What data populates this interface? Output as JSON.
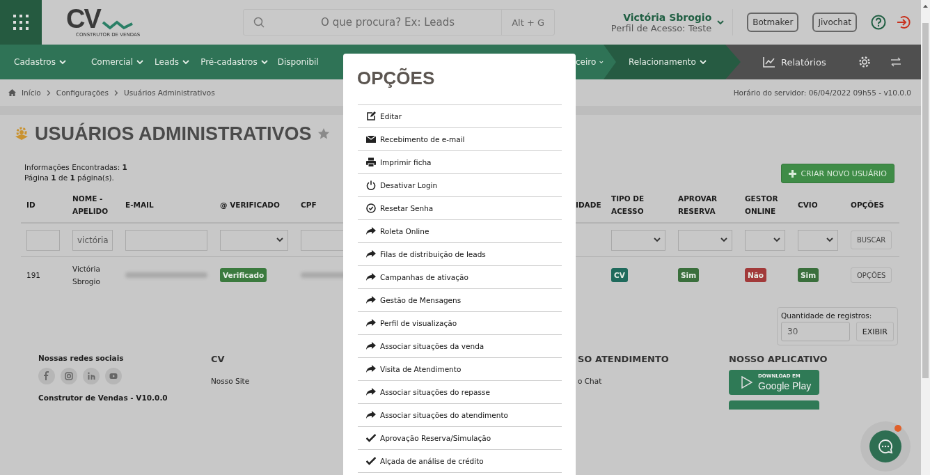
{
  "header": {
    "logo": {
      "mark": "CV",
      "tagline": "CONSTRUTOR DE VENDAS"
    },
    "search": {
      "placeholder": "O que procura? Ex: Leads",
      "shortcut": "Alt + G"
    },
    "user": {
      "name": "Victória Sbrogio",
      "profile": "Perfil de Acesso: Teste"
    },
    "buttons": [
      "Botmaker",
      "Jivochat"
    ]
  },
  "nav": {
    "items": [
      {
        "label": "Cadastros",
        "caret": true,
        "highlighted": false
      },
      {
        "label": "Comercial",
        "caret": true,
        "highlighted": false
      },
      {
        "label": "Leads",
        "caret": true,
        "highlighted": false
      },
      {
        "label": "Pré-cadastros",
        "caret": true,
        "highlighted": false
      },
      {
        "label": "Disponibil",
        "highlighted": false
      },
      {
        "label": "ceiro",
        "caret": true,
        "highlighted": false
      },
      {
        "label": "Relacionamento",
        "caret": true,
        "highlighted": true
      }
    ],
    "reports": "Relatórios"
  },
  "breadcrumb": [
    "Início",
    "Configurações",
    "Usuários Administrativos"
  ],
  "server_time": "Horário do servidor: 06/04/2022 09h55 - v10.0.0",
  "page": {
    "title": "USUÁRIOS ADMINISTRATIVOS",
    "favorite": false,
    "info": [
      "Informações Encontradas: **1**",
      "Página **1** de **1** página(s)."
    ],
    "create_button": "CRIAR NOVO USUÁRIO"
  },
  "table": {
    "columns": [
      {
        "label": "ID",
        "filter": {
          "kind": "text"
        }
      },
      {
        "label": "NOME - APELIDO",
        "filter": {
          "kind": "text",
          "value": "victória"
        }
      },
      {
        "label": "E-MAIL",
        "filter": {
          "kind": "text"
        }
      },
      {
        "label": "@ VERIFICADO",
        "filter": {
          "kind": "select"
        }
      },
      {
        "label": "CPF",
        "filter": {
          "kind": "text"
        }
      },
      {
        "label": "IDADE"
      },
      {
        "label": "TIPO DE ACESSO",
        "filter": {
          "kind": "select"
        }
      },
      {
        "label": "APROVAR RESERVA",
        "filter": {
          "kind": "select"
        }
      },
      {
        "label": "GESTOR ONLINE",
        "filter": {
          "kind": "select"
        }
      },
      {
        "label": "CVIO",
        "filter": {
          "kind": "select"
        }
      },
      {
        "label": "OPÇÕES",
        "filter": {
          "kind": "button",
          "button": "BUSCAR"
        }
      }
    ],
    "rows": [
      {
        "cells": [
          {
            "kind": "text",
            "text": "191"
          },
          {
            "kind": "text",
            "text": "Victória Sbrogio"
          },
          {
            "kind": "redacted"
          },
          {
            "kind": "badge",
            "text": "Verificado",
            "color": "#3b7a3e"
          },
          {
            "kind": "redacted"
          },
          {
            "kind": "empty"
          },
          {
            "kind": "badge",
            "text": "CV",
            "color": "#1f6a5c"
          },
          {
            "kind": "badge",
            "text": "Sim",
            "color": "#3a6f3c"
          },
          {
            "kind": "badge",
            "text": "Não",
            "color": "#a23a3a"
          },
          {
            "kind": "badge",
            "text": "Sim",
            "color": "#3a6f3c"
          },
          {
            "kind": "button",
            "text": "OPÇÕES"
          }
        ]
      }
    ]
  },
  "records": {
    "label": "Quantidade de registros:",
    "value": "30",
    "button": "EXIBIR"
  },
  "footer": {
    "social": {
      "title": "Nossas redes sociais",
      "version": "Construtor de Vendas - V10.0.0"
    },
    "columns": [
      {
        "title": "CV",
        "links": [
          "Nosso Site"
        ]
      },
      {
        "title": "SO ATENDIMENTO",
        "links": [
          "o Chat"
        ]
      }
    ],
    "app": {
      "title": "NOSSO APLICATIVO",
      "badge_small": "DOWNLOAD EM",
      "badge_store": "Google Play"
    }
  },
  "chat": {
    "notification": true
  },
  "modal": {
    "title": "OPÇÕES",
    "items": [
      {
        "label": "Editar",
        "kind": "edit"
      },
      {
        "label": "Recebimento de e-mail",
        "kind": "mail"
      },
      {
        "label": "Imprimir ficha",
        "kind": "print"
      },
      {
        "label": "Desativar Login",
        "kind": "power"
      },
      {
        "label": "Resetar Senha",
        "kind": "check-circle"
      },
      {
        "label": "Roleta Online",
        "kind": "share"
      },
      {
        "label": "Filas de distribuição de leads",
        "kind": "share"
      },
      {
        "label": "Campanhas de ativação",
        "kind": "share"
      },
      {
        "label": "Gestão de Mensagens",
        "kind": "share"
      },
      {
        "label": "Perfil de visualização",
        "kind": "share"
      },
      {
        "label": "Associar situações da venda",
        "kind": "share"
      },
      {
        "label": "Visita de Atendimento",
        "kind": "share"
      },
      {
        "label": "Associar situações do repasse",
        "kind": "share"
      },
      {
        "label": "Associar situações do atendimento",
        "kind": "share"
      },
      {
        "label": "Aprovação Reserva/Simulação",
        "kind": "check"
      },
      {
        "label": "Alçada de análise de crédito",
        "kind": "check"
      }
    ]
  }
}
